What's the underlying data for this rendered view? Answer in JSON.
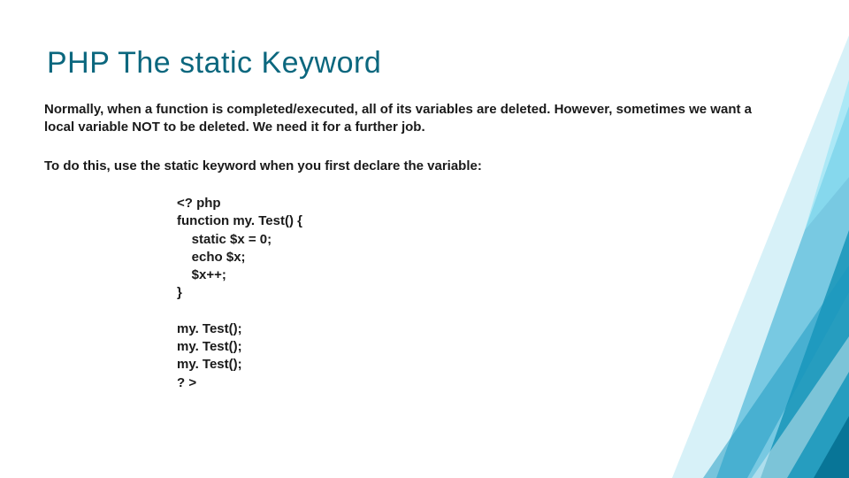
{
  "title": "PHP The static Keyword",
  "para1": "Normally, when a function is completed/executed, all of its variables are deleted. However, sometimes we want a local variable NOT to be deleted. We need it for a further job.",
  "para2": "To do this, use the static keyword when you first declare the variable:",
  "code": "<? php\nfunction my. Test() {\n    static $x = 0;\n    echo $x;\n    $x++;\n}\n\nmy. Test();\nmy. Test();\nmy. Test();\n? >"
}
